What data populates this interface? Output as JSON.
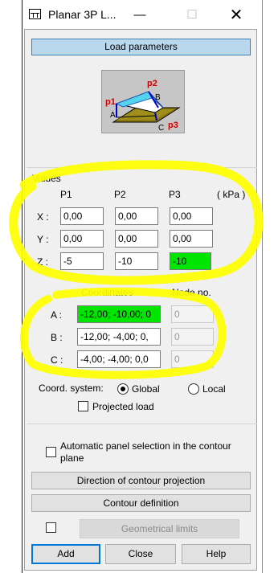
{
  "window": {
    "title": "Planar 3P L...",
    "minimize": "—",
    "maximize": "☐",
    "close": "✕"
  },
  "header": {
    "label": "Load parameters"
  },
  "diagram": {
    "labels": {
      "p1": "p1",
      "p2": "p2",
      "p3": "p3",
      "a": "A",
      "b": "B",
      "c": "C"
    }
  },
  "values": {
    "section_label": "Values",
    "columns": [
      "P1",
      "P2",
      "P3"
    ],
    "unit": "( kPa )",
    "rows": [
      {
        "label": "X :",
        "values": [
          "0,00",
          "0,00",
          "0,00"
        ]
      },
      {
        "label": "Y :",
        "values": [
          "0,00",
          "0,00",
          "0,00"
        ]
      },
      {
        "label": "Z :",
        "values": [
          "-5",
          "-10",
          "-10"
        ]
      }
    ]
  },
  "coordinates": {
    "header": "Coordinates",
    "node_header": "Node no.",
    "rows": [
      {
        "label": "A :",
        "value": "-12,00; -10,00; 0",
        "node": "0"
      },
      {
        "label": "B :",
        "value": "-12,00; -4,00; 0,",
        "node": "0"
      },
      {
        "label": "C :",
        "value": "-4,00; -4,00; 0,0",
        "node": "0"
      }
    ]
  },
  "coord_system": {
    "label": "Coord. system:",
    "options": [
      "Global",
      "Local"
    ],
    "selected": "Global",
    "projected_load": "Projected load"
  },
  "auto_panel": {
    "label_line1": "Automatic panel selection in the contour",
    "label_line2": "plane"
  },
  "buttons": {
    "direction": "Direction of contour projection",
    "contour": "Contour definition",
    "geometrical_limits": "Geometrical limits",
    "add": "Add",
    "close": "Close",
    "help": "Help"
  },
  "colors": {
    "highlight": "#00e600",
    "header_bg": "#b9d8ee",
    "annotation": "#ffff00"
  }
}
